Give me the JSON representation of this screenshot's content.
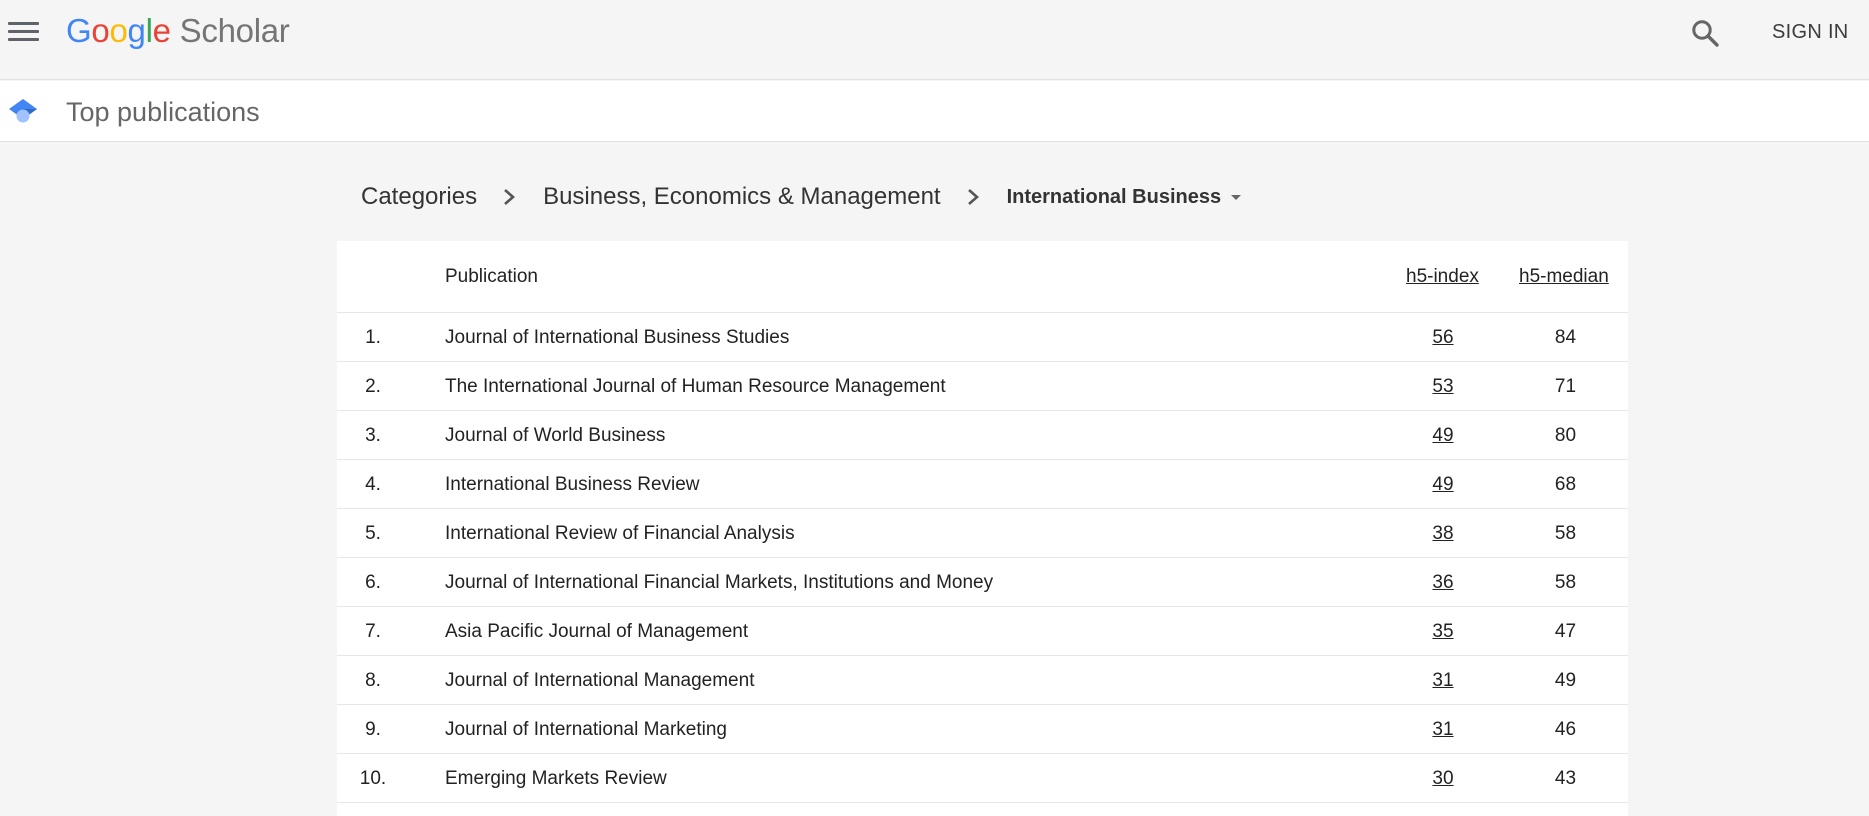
{
  "header": {
    "logo": {
      "google_letters": [
        "G",
        "o",
        "o",
        "g",
        "l",
        "e"
      ],
      "product": "Scholar"
    },
    "sign_in_label": "SIGN IN",
    "colors": {
      "google_blue": "#4285f4",
      "google_red": "#ea4335",
      "google_yellow": "#fbbc05",
      "google_green": "#34a853",
      "scholar_gray": "#757575"
    }
  },
  "page": {
    "title": "Top publications",
    "icon": "graduation-cap-icon"
  },
  "breadcrumb": {
    "items": [
      "Categories",
      "Business, Economics & Management"
    ],
    "current": "International Business"
  },
  "table": {
    "columns": {
      "publication": "Publication",
      "h5_index": "h5-index",
      "h5_median": "h5-median"
    },
    "rows": [
      {
        "rank": "1.",
        "publication": "Journal of International Business Studies",
        "h5_index": "56",
        "h5_median": "84"
      },
      {
        "rank": "2.",
        "publication": "The International Journal of Human Resource Management",
        "h5_index": "53",
        "h5_median": "71"
      },
      {
        "rank": "3.",
        "publication": "Journal of World Business",
        "h5_index": "49",
        "h5_median": "80"
      },
      {
        "rank": "4.",
        "publication": "International Business Review",
        "h5_index": "49",
        "h5_median": "68"
      },
      {
        "rank": "5.",
        "publication": "International Review of Financial Analysis",
        "h5_index": "38",
        "h5_median": "58"
      },
      {
        "rank": "6.",
        "publication": "Journal of International Financial Markets, Institutions and Money",
        "h5_index": "36",
        "h5_median": "58"
      },
      {
        "rank": "7.",
        "publication": "Asia Pacific Journal of Management",
        "h5_index": "35",
        "h5_median": "47"
      },
      {
        "rank": "8.",
        "publication": "Journal of International Management",
        "h5_index": "31",
        "h5_median": "49"
      },
      {
        "rank": "9.",
        "publication": "Journal of International Marketing",
        "h5_index": "31",
        "h5_median": "46"
      },
      {
        "rank": "10.",
        "publication": "Emerging Markets Review",
        "h5_index": "30",
        "h5_median": "43"
      }
    ]
  }
}
